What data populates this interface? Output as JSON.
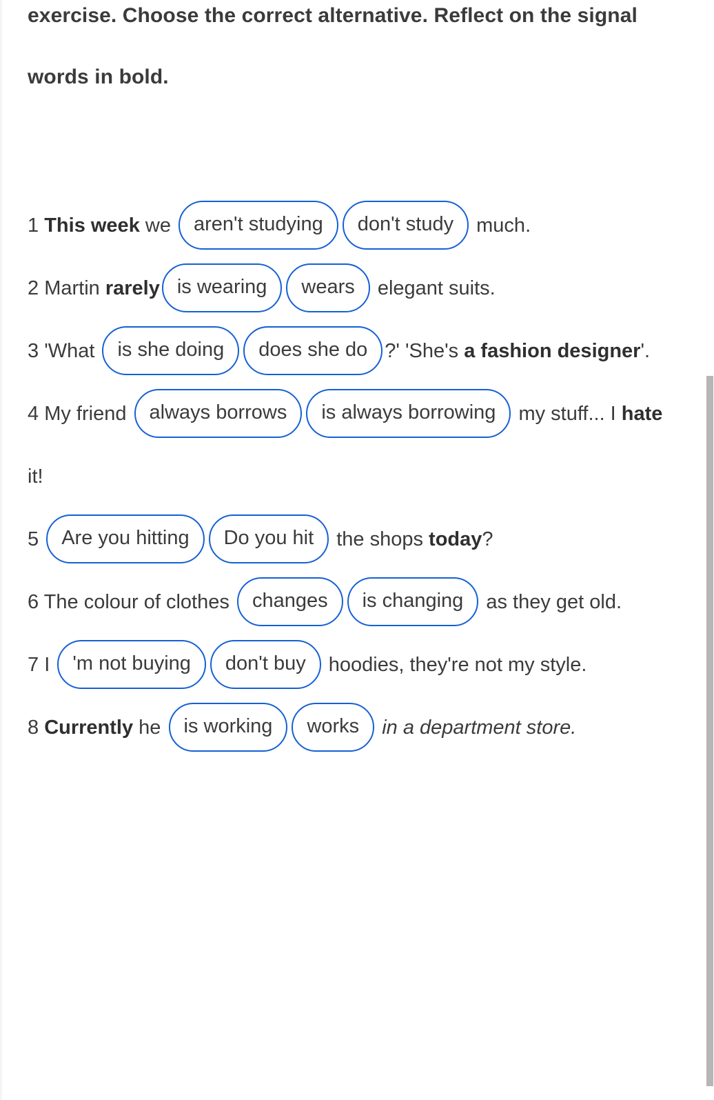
{
  "instruction": {
    "text": "exercise. Choose the correct alternative. Reflect on the signal words in bold."
  },
  "colors": {
    "option_border": "#1560d4",
    "text": "#3b3b3b",
    "background": "#ffffff",
    "scrollbar_thumb": "#b6b6b6"
  },
  "exercise": {
    "items": [
      {
        "number": "1",
        "before_bold": "",
        "bold": "This week",
        "mid": " we ",
        "options": [
          "aren't studying",
          "don't study"
        ],
        "after": " much."
      },
      {
        "number": "2",
        "before_bold": " Martin ",
        "bold": "rarely",
        "mid": "",
        "options": [
          "is wearing",
          "wears"
        ],
        "after": " elegant suits."
      },
      {
        "number": "3",
        "before_bold": " 'What ",
        "bold": "",
        "mid": "",
        "options": [
          "is she doing",
          "does she do"
        ],
        "after_plain": "?' 'She's ",
        "after_bold": "a fashion designer",
        "after_tail": "'."
      },
      {
        "number": "4",
        "before_bold": " My friend ",
        "bold": "",
        "mid": "",
        "options": [
          "always borrows",
          "is always borrowing"
        ],
        "after_plain": " my stuff... I ",
        "after_bold": "hate",
        "after_tail": " it!"
      },
      {
        "number": "5",
        "before_bold": " ",
        "bold": "",
        "mid": "",
        "options": [
          "Are you hitting",
          "Do you hit"
        ],
        "after_plain": " the shops ",
        "after_bold": "today",
        "after_tail": "?"
      },
      {
        "number": "6",
        "before_bold": " The colour of clothes ",
        "bold": "",
        "mid": "",
        "options": [
          "changes",
          "is changing"
        ],
        "after": " as they get old."
      },
      {
        "number": "7",
        "before_bold": " I ",
        "bold": "",
        "mid": "",
        "options": [
          "'m not buying",
          "don't buy"
        ],
        "after": " hoodies, they're not my style."
      },
      {
        "number": "8",
        "before_bold": " ",
        "bold": "Currently",
        "mid": " he ",
        "options": [
          "is working",
          "works"
        ],
        "after_italic": " in a department store."
      }
    ]
  }
}
